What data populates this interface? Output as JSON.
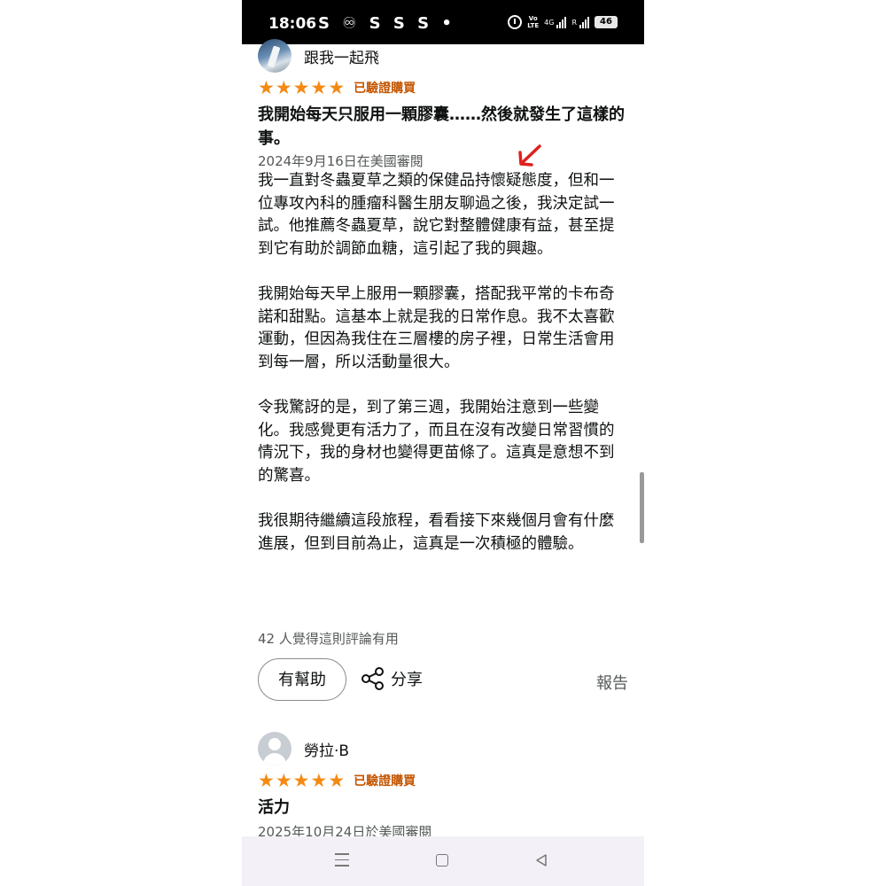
{
  "status_bar": {
    "time": "18:06",
    "notification_icons": "S ♾ S S S •",
    "volte_label": "Vo\nLTE",
    "network_4g": "4G",
    "roaming": "R",
    "battery": "46"
  },
  "reviews": [
    {
      "reviewer": "跟我一起飛",
      "rating": 5,
      "verified": "已驗證購買",
      "title": "我開始每天只服用一顆膠囊……然後就發生了這樣的事。",
      "date": "2024年9月16日在美國審閱",
      "paragraphs": [
        "我一直對冬蟲夏草之類的保健品持懷疑態度，但和一位專攻內科的腫瘤科醫生朋友聊過之後，我決定試一試。他推薦冬蟲夏草，說它對整體健康有益，甚至提到它有助於調節血糖，這引起了我的興趣。",
        "我開始每天早上服用一顆膠囊，搭配我平常的卡布奇諾和甜點。這基本上就是我的日常作息。我不太喜歡運動，但因為我住在三層樓的房子裡，日常生活會用到每一層，所以活動量很大。",
        "令我驚訝的是，到了第三週，我開始注意到一些變化。我感覺更有活力了，而且在沒有改變日常習慣的情況下，我的身材也變得更苗條了。這真是意想不到的驚喜。",
        "我很期待繼續這段旅程，看看接下來幾個月會有什麼進展，但到目前為止，這真是一次積極的體驗。"
      ],
      "helpful_count": "42 人覺得這則評論有用",
      "helpful_button": "有幫助",
      "share_label": "分享",
      "report_label": "報告"
    },
    {
      "reviewer": "勞拉·B",
      "rating": 5,
      "verified": "已驗證購買",
      "title": "活力",
      "date": "2025年10月24日於美國審閱"
    }
  ],
  "colors": {
    "star": "#f48a14",
    "verified": "#c45500",
    "annotation_arrow": "#e0201e"
  }
}
